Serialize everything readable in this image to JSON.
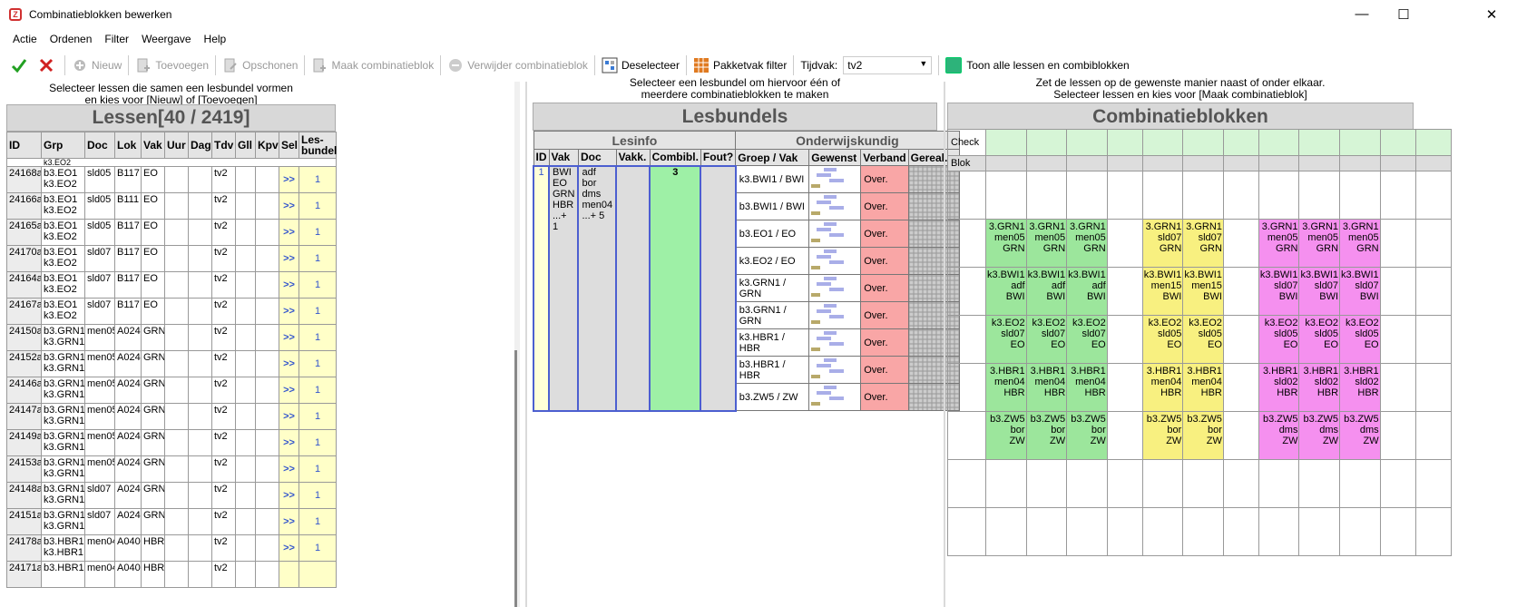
{
  "window": {
    "title": "Combinatieblokken bewerken",
    "minimize": "—",
    "maximize": "☐",
    "close": "✕"
  },
  "menu": [
    "Actie",
    "Ordenen",
    "Filter",
    "Weergave",
    "Help"
  ],
  "toolbar": {
    "nieuw": "Nieuw",
    "toevoegen": "Toevoegen",
    "opschonen": "Opschonen",
    "maak": "Maak combinatieblok",
    "verwijder": "Verwijder combinatieblok",
    "deselecteer": "Deselecteer",
    "pakketvak": "Pakketvak filter",
    "tijdvak_label": "Tijdvak:",
    "tijdvak_value": "tv2",
    "toon": "Toon alle lessen en combiblokken"
  },
  "lessen": {
    "hint1": "Selecteer lessen die samen een lesbundel vormen",
    "hint2": "en kies voor [Nieuw] of [Toevoegen]",
    "title": "Lessen[40 / 2419]",
    "columns": [
      "ID",
      "Grp",
      "Doc",
      "Lok",
      "Vak",
      "Uur",
      "Dag",
      "Tdv",
      "Gll",
      "Kpv",
      "Sel",
      "Les-bundel"
    ],
    "partial_top": "k3.EO2",
    "rows": [
      {
        "id": "24168a",
        "grp1": "b3.EO1",
        "grp2": "k3.EO2",
        "doc": "sld05",
        "lok": "B117",
        "vak": "EO",
        "tdv": "tv2",
        "sel": ">>",
        "bundel": "1"
      },
      {
        "id": "24166a",
        "grp1": "b3.EO1",
        "grp2": "k3.EO2",
        "doc": "sld05",
        "lok": "B111",
        "vak": "EO",
        "tdv": "tv2",
        "sel": ">>",
        "bundel": "1"
      },
      {
        "id": "24165a",
        "grp1": "b3.EO1",
        "grp2": "k3.EO2",
        "doc": "sld05",
        "lok": "B117",
        "vak": "EO",
        "tdv": "tv2",
        "sel": ">>",
        "bundel": "1"
      },
      {
        "id": "24170a",
        "grp1": "b3.EO1",
        "grp2": "k3.EO2",
        "doc": "sld07",
        "lok": "B117",
        "vak": "EO",
        "tdv": "tv2",
        "sel": ">>",
        "bundel": "1"
      },
      {
        "id": "24164a",
        "grp1": "b3.EO1",
        "grp2": "k3.EO2",
        "doc": "sld07",
        "lok": "B117",
        "vak": "EO",
        "tdv": "tv2",
        "sel": ">>",
        "bundel": "1"
      },
      {
        "id": "24167a",
        "grp1": "b3.EO1",
        "grp2": "k3.EO2",
        "doc": "sld07",
        "lok": "B117",
        "vak": "EO",
        "tdv": "tv2",
        "sel": ">>",
        "bundel": "1"
      },
      {
        "id": "24150a",
        "grp1": "b3.GRN1",
        "grp2": "k3.GRN1",
        "doc": "men05",
        "lok": "A024",
        "vak": "GRN",
        "tdv": "tv2",
        "sel": ">>",
        "bundel": "1"
      },
      {
        "id": "24152a",
        "grp1": "b3.GRN1",
        "grp2": "k3.GRN1",
        "doc": "men05",
        "lok": "A024",
        "vak": "GRN",
        "tdv": "tv2",
        "sel": ">>",
        "bundel": "1"
      },
      {
        "id": "24146a",
        "grp1": "b3.GRN1",
        "grp2": "k3.GRN1",
        "doc": "men05",
        "lok": "A024",
        "vak": "GRN",
        "tdv": "tv2",
        "sel": ">>",
        "bundel": "1"
      },
      {
        "id": "24147a",
        "grp1": "b3.GRN1",
        "grp2": "k3.GRN1",
        "doc": "men05",
        "lok": "A024",
        "vak": "GRN",
        "tdv": "tv2",
        "sel": ">>",
        "bundel": "1"
      },
      {
        "id": "24149a",
        "grp1": "b3.GRN1",
        "grp2": "k3.GRN1",
        "doc": "men05",
        "lok": "A024",
        "vak": "GRN",
        "tdv": "tv2",
        "sel": ">>",
        "bundel": "1"
      },
      {
        "id": "24153a",
        "grp1": "b3.GRN1",
        "grp2": "k3.GRN1",
        "doc": "men05",
        "lok": "A024",
        "vak": "GRN",
        "tdv": "tv2",
        "sel": ">>",
        "bundel": "1"
      },
      {
        "id": "24148a",
        "grp1": "b3.GRN1",
        "grp2": "k3.GRN1",
        "doc": "sld07",
        "lok": "A024",
        "vak": "GRN",
        "tdv": "tv2",
        "sel": ">>",
        "bundel": "1"
      },
      {
        "id": "24151a",
        "grp1": "b3.GRN1",
        "grp2": "k3.GRN1",
        "doc": "sld07",
        "lok": "A024",
        "vak": "GRN",
        "tdv": "tv2",
        "sel": ">>",
        "bundel": "1"
      },
      {
        "id": "24178a",
        "grp1": "b3.HBR1",
        "grp2": "k3.HBR1",
        "doc": "men04",
        "lok": "A040",
        "vak": "HBR",
        "tdv": "tv2",
        "sel": ">>",
        "bundel": "1"
      },
      {
        "id": "24171a",
        "grp1": "b3.HBR1",
        "grp2": "",
        "doc": "men04",
        "lok": "A040",
        "vak": "HBR",
        "tdv": "tv2",
        "sel": "",
        "bundel": ""
      }
    ]
  },
  "lesbundels": {
    "hint1": "Selecteer een lesbundel om hiervoor één of",
    "hint2": "meerdere combinatieblokken te maken",
    "title": "Lesbundels",
    "group_lesinfo": "Lesinfo",
    "group_onderwijs": "Onderwijskundig",
    "columns": [
      "ID",
      "Vak",
      "Doc",
      "Vakk.",
      "Combibl.",
      "Fout?",
      "Groep / Vak",
      "Gewenst",
      "Verband",
      "Gereal."
    ],
    "bundle": {
      "id": "1",
      "vak": [
        "BWI",
        "EO",
        "GRN",
        "HBR",
        "...+ 1"
      ],
      "doc": [
        "adf",
        "bor",
        "dms",
        "men04",
        "...+ 5"
      ],
      "combibl": "3"
    },
    "rows": [
      {
        "groep": "k3.BWI1 / BWI",
        "verband": "Over."
      },
      {
        "groep": "b3.BWI1 / BWI",
        "verband": "Over."
      },
      {
        "groep": "b3.EO1 / EO",
        "verband": "Over."
      },
      {
        "groep": "k3.EO2 / EO",
        "verband": "Over."
      },
      {
        "groep": "k3.GRN1 / GRN",
        "verband": "Over."
      },
      {
        "groep": "b3.GRN1 / GRN",
        "verband": "Over."
      },
      {
        "groep": "k3.HBR1 / HBR",
        "verband": "Over."
      },
      {
        "groep": "b3.HBR1 / HBR",
        "verband": "Over."
      },
      {
        "groep": "b3.ZW5 / ZW",
        "verband": "Over."
      }
    ]
  },
  "combi": {
    "hint1": "Zet de lessen op de gewenste manier naast of onder elkaar.",
    "hint2": "Selecteer lessen en kies voor [Maak combinatieblok]",
    "title": "Combinatieblokken",
    "check_label": "Check",
    "blok_label": "Blok",
    "rows": [
      [],
      [
        {
          "c": "g",
          "t": [
            "3.GRN1",
            "men05",
            "GRN"
          ]
        },
        {
          "c": "g",
          "t": [
            "3.GRN1",
            "men05",
            "GRN"
          ]
        },
        {
          "c": "g",
          "t": [
            "3.GRN1",
            "men05",
            "GRN"
          ]
        },
        {},
        {
          "c": "y",
          "t": [
            "3.GRN1",
            "sld07",
            "GRN"
          ]
        },
        {
          "c": "y",
          "t": [
            "3.GRN1",
            "sld07",
            "GRN"
          ]
        },
        {},
        {
          "c": "m",
          "t": [
            "3.GRN1",
            "men05",
            "GRN"
          ]
        },
        {
          "c": "m",
          "t": [
            "3.GRN1",
            "men05",
            "GRN"
          ]
        },
        {
          "c": "m",
          "t": [
            "3.GRN1",
            "men05",
            "GRN"
          ]
        }
      ],
      [
        {
          "c": "g",
          "t": [
            "k3.BWI1",
            "adf",
            "BWI"
          ]
        },
        {
          "c": "g",
          "t": [
            "k3.BWI1",
            "adf",
            "BWI"
          ]
        },
        {
          "c": "g",
          "t": [
            "k3.BWI1",
            "adf",
            "BWI"
          ]
        },
        {},
        {
          "c": "y",
          "t": [
            "k3.BWI1",
            "men15",
            "BWI"
          ]
        },
        {
          "c": "y",
          "t": [
            "k3.BWI1",
            "men15",
            "BWI"
          ]
        },
        {},
        {
          "c": "m",
          "t": [
            "k3.BWI1",
            "sld07",
            "BWI"
          ]
        },
        {
          "c": "m",
          "t": [
            "k3.BWI1",
            "sld07",
            "BWI"
          ]
        },
        {
          "c": "m",
          "t": [
            "k3.BWI1",
            "sld07",
            "BWI"
          ]
        }
      ],
      [
        {
          "c": "g",
          "t": [
            "k3.EO2",
            "sld07",
            "EO"
          ]
        },
        {
          "c": "g",
          "t": [
            "k3.EO2",
            "sld07",
            "EO"
          ]
        },
        {
          "c": "g",
          "t": [
            "k3.EO2",
            "sld07",
            "EO"
          ]
        },
        {},
        {
          "c": "y",
          "t": [
            "k3.EO2",
            "sld05",
            "EO"
          ]
        },
        {
          "c": "y",
          "t": [
            "k3.EO2",
            "sld05",
            "EO"
          ]
        },
        {},
        {
          "c": "m",
          "t": [
            "k3.EO2",
            "sld05",
            "EO"
          ]
        },
        {
          "c": "m",
          "t": [
            "k3.EO2",
            "sld05",
            "EO"
          ]
        },
        {
          "c": "m",
          "t": [
            "k3.EO2",
            "sld05",
            "EO"
          ]
        }
      ],
      [
        {
          "c": "g",
          "t": [
            "3.HBR1",
            "men04",
            "HBR"
          ]
        },
        {
          "c": "g",
          "t": [
            "3.HBR1",
            "men04",
            "HBR"
          ]
        },
        {
          "c": "g",
          "t": [
            "3.HBR1",
            "men04",
            "HBR"
          ]
        },
        {},
        {
          "c": "y",
          "t": [
            "3.HBR1",
            "men04",
            "HBR"
          ]
        },
        {
          "c": "y",
          "t": [
            "3.HBR1",
            "men04",
            "HBR"
          ]
        },
        {},
        {
          "c": "m",
          "t": [
            "3.HBR1",
            "sld02",
            "HBR"
          ]
        },
        {
          "c": "m",
          "t": [
            "3.HBR1",
            "sld02",
            "HBR"
          ]
        },
        {
          "c": "m",
          "t": [
            "3.HBR1",
            "sld02",
            "HBR"
          ]
        }
      ],
      [
        {
          "c": "g",
          "t": [
            "b3.ZW5",
            "bor",
            "ZW"
          ]
        },
        {
          "c": "g",
          "t": [
            "b3.ZW5",
            "bor",
            "ZW"
          ]
        },
        {
          "c": "g",
          "t": [
            "b3.ZW5",
            "bor",
            "ZW"
          ]
        },
        {},
        {
          "c": "y",
          "t": [
            "b3.ZW5",
            "bor",
            "ZW"
          ]
        },
        {
          "c": "y",
          "t": [
            "b3.ZW5",
            "bor",
            "ZW"
          ]
        },
        {},
        {
          "c": "m",
          "t": [
            "b3.ZW5",
            "dms",
            "ZW"
          ]
        },
        {
          "c": "m",
          "t": [
            "b3.ZW5",
            "dms",
            "ZW"
          ]
        },
        {
          "c": "m",
          "t": [
            "b3.ZW5",
            "dms",
            "ZW"
          ]
        }
      ],
      [],
      []
    ]
  },
  "colors": {
    "accent_blue": "#4c5fd0",
    "green": "#9ce69c",
    "yellow": "#f8f080",
    "magenta": "#f590ef",
    "verband": "#f9a6a6"
  }
}
